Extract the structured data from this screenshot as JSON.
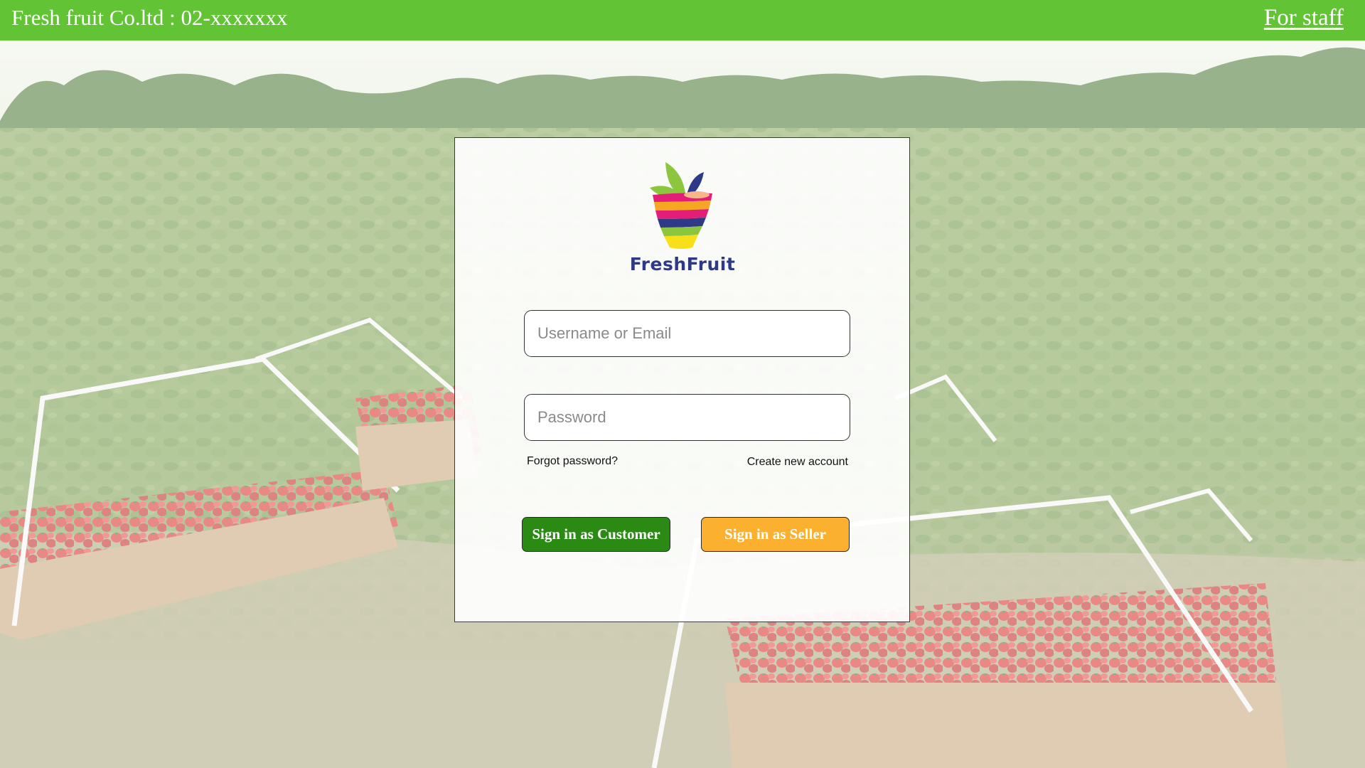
{
  "header": {
    "company": "Fresh fruit Co.ltd : 02-xxxxxxx",
    "staff_link": "For staff"
  },
  "login": {
    "brand_name": "FreshFruit",
    "username_placeholder": "Username or Email",
    "password_placeholder": "Password",
    "forgot_password": "Forgot password?",
    "create_account": "Create new account",
    "customer_button": "Sign in as Customer",
    "seller_button": "Sign in as Seller"
  },
  "colors": {
    "header_bg": "#62c434",
    "customer_button_bg": "#2a8a14",
    "seller_button_bg": "#fbb12f",
    "brand_text": "#2e3a87"
  },
  "background": {
    "scene": "strawberry field with fruit crates"
  }
}
